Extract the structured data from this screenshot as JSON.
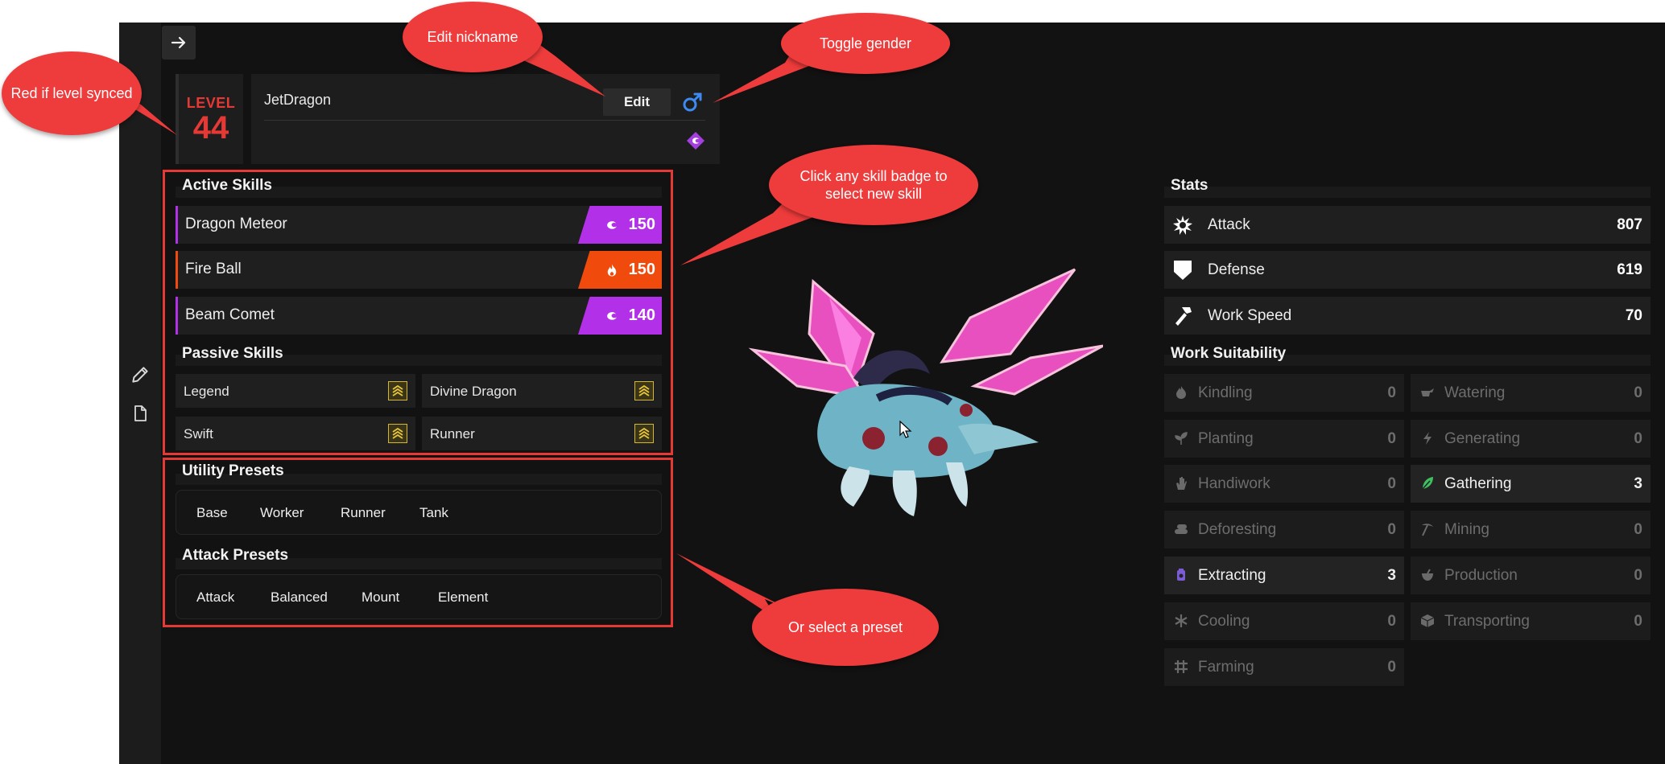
{
  "app": {
    "back_icon": "arrow-right-icon",
    "side_icons": [
      "pencil-icon",
      "document-icon"
    ]
  },
  "header": {
    "level_label": "LEVEL",
    "level_value": "44",
    "nickname": "JetDragon",
    "edit_label": "Edit",
    "gender_symbol": "♂",
    "element": "dragon"
  },
  "active_skills": {
    "title": "Active Skills",
    "items": [
      {
        "name": "Dragon Meteor",
        "power": "150",
        "element": "dragon",
        "color": "#b231e8"
      },
      {
        "name": "Fire Ball",
        "power": "150",
        "element": "fire",
        "color": "#f04a0d"
      },
      {
        "name": "Beam Comet",
        "power": "140",
        "element": "dragon",
        "color": "#b231e8"
      }
    ]
  },
  "passive_skills": {
    "title": "Passive Skills",
    "items": [
      {
        "name": "Legend"
      },
      {
        "name": "Divine Dragon"
      },
      {
        "name": "Swift"
      },
      {
        "name": "Runner"
      }
    ]
  },
  "utility_presets": {
    "title": "Utility Presets",
    "items": [
      "Base",
      "Worker",
      "Runner",
      "Tank"
    ]
  },
  "attack_presets": {
    "title": "Attack Presets",
    "items": [
      "Attack",
      "Balanced",
      "Mount",
      "Element"
    ]
  },
  "stats": {
    "title": "Stats",
    "items": [
      {
        "name": "Attack",
        "value": "807",
        "icon": "attack-burst-icon"
      },
      {
        "name": "Defense",
        "value": "619",
        "icon": "shield-icon"
      },
      {
        "name": "Work Speed",
        "value": "70",
        "icon": "hammer-icon"
      }
    ]
  },
  "work_suitability": {
    "title": "Work Suitability",
    "items": [
      {
        "name": "Kindling",
        "value": "0",
        "active": false
      },
      {
        "name": "Watering",
        "value": "0",
        "active": false
      },
      {
        "name": "Planting",
        "value": "0",
        "active": false
      },
      {
        "name": "Generating",
        "value": "0",
        "active": false
      },
      {
        "name": "Handiwork",
        "value": "0",
        "active": false
      },
      {
        "name": "Gathering",
        "value": "3",
        "active": true
      },
      {
        "name": "Deforesting",
        "value": "0",
        "active": false
      },
      {
        "name": "Mining",
        "value": "0",
        "active": false
      },
      {
        "name": "Extracting",
        "value": "3",
        "active": true
      },
      {
        "name": "Production",
        "value": "0",
        "active": false
      },
      {
        "name": "Cooling",
        "value": "0",
        "active": false
      },
      {
        "name": "Transporting",
        "value": "0",
        "active": false
      },
      {
        "name": "Farming",
        "value": "0",
        "active": false
      }
    ]
  },
  "callouts": {
    "level": "Red if level synced",
    "nickname": "Edit nickname",
    "gender": "Toggle gender",
    "skill": "Click any skill badge to select new skill",
    "preset": "Or select a preset"
  },
  "colors": {
    "accent_red": "#e53935",
    "dragon": "#b231e8",
    "fire": "#f04a0d",
    "gender_blue": "#3d8bf2",
    "gathering_green": "#3fbf5f",
    "extracting_purple": "#7c5cd6"
  }
}
